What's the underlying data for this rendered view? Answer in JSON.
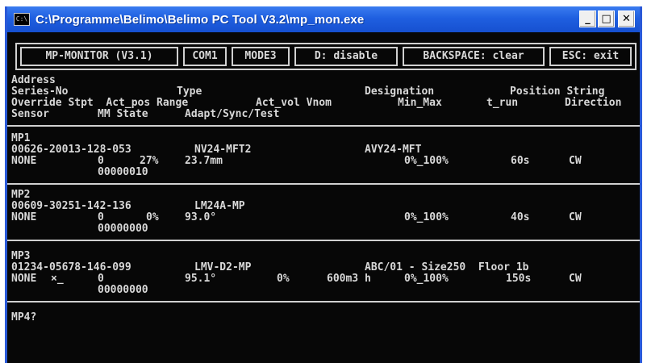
{
  "window": {
    "title": "C:\\Programme\\Belimo\\Belimo PC Tool V3.2\\mp_mon.exe",
    "icon": "console-icon",
    "buttons": {
      "minimize": "_",
      "maximize": "□",
      "close": "✕"
    }
  },
  "menu": {
    "monitor": "MP-MONITOR (V3.1)",
    "port": "COM1",
    "mode": "MODE3",
    "d_key": "D: disable",
    "backspace": "BACKSPACE: clear",
    "esc": "ESC: exit"
  },
  "header": {
    "line1": "Address",
    "line2_left": "Series-No",
    "line2_type": "Type",
    "line2_designation": "Designation",
    "line2_position": "Position String",
    "line3_left": "Override Stpt  Act_pos Range",
    "line3_actvol": "Act_vol Vnom",
    "line3_minmax": "Min_Max",
    "line3_trun": "t_run",
    "line3_direction": "Direction",
    "line4_left": "Sensor",
    "line4_mm": "MM State",
    "line4_adapt": "Adapt/Sync/Test"
  },
  "devices": [
    {
      "address": "MP1",
      "serial": "00626-20013-128-053",
      "type": "NV24-MFT2",
      "designation": "AVY24-MFT",
      "override": "NONE",
      "stpt": "0",
      "act_pos": "27%",
      "range": "23.7mm",
      "act_vol": "",
      "vnom": "",
      "min_max": "0%_100%",
      "t_run": "60s",
      "direction": "CW",
      "state": "00000010"
    },
    {
      "address": "MP2",
      "serial": "00609-30251-142-136",
      "type": "LM24A-MP",
      "designation": "",
      "override": "NONE",
      "stpt": "0",
      "act_pos": "0%",
      "range": "93.0°",
      "act_vol": "",
      "vnom": "",
      "min_max": "0%_100%",
      "t_run": "40s",
      "direction": "CW",
      "state": "00000000"
    },
    {
      "address": "MP3",
      "serial": "01234-05678-146-099",
      "type": "LMV-D2-MP",
      "designation": "ABC/01 - Size250  Floor 1b",
      "override": "NONE",
      "override_mark": "×_",
      "stpt": "0",
      "act_pos": "",
      "range": "95.1°",
      "act_vol": "0%",
      "vnom": "600m3 h",
      "min_max": "0%_100%",
      "t_run": "150s",
      "direction": "CW",
      "state": "00000000"
    }
  ],
  "prompt": "MP4?"
}
